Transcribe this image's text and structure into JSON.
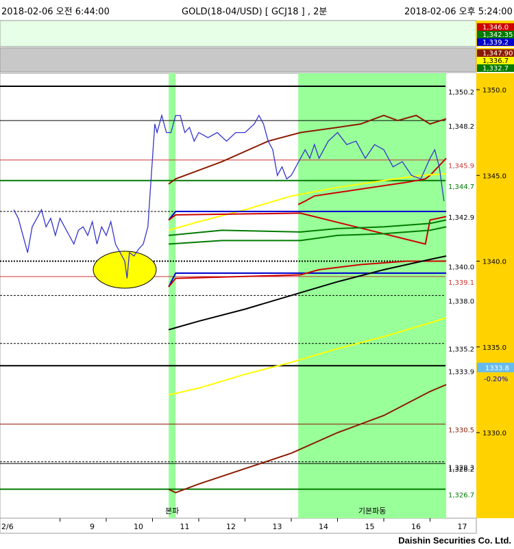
{
  "header": {
    "start_time": "2018-02-06 오전 6:44:00",
    "title": "GOLD(18-04/USD)  [ GCJ18 ] , 2분",
    "end_time": "2018-02-06 오후 5:24:00"
  },
  "top_panel": {
    "labels": [
      {
        "text": "1,346.0",
        "bg": "#cc0000",
        "color": "#ffffff"
      },
      {
        "text": "1,342.35",
        "bg": "#007a00",
        "color": "#ffffff"
      },
      {
        "text": "1,339.2",
        "bg": "#0000cc",
        "color": "#ffffff"
      }
    ]
  },
  "second_panel": {
    "labels": [
      {
        "text": "1,347.90",
        "bg": "#8b1a00",
        "color": "#ffffff"
      },
      {
        "text": "1,336.7",
        "bg": "#ffff00",
        "color": "#000000"
      },
      {
        "text": "1,332.7",
        "bg": "#007a00",
        "color": "#ffffff"
      }
    ]
  },
  "footer": {
    "company": "Daishin Securities Co. Ltd."
  },
  "chart_data": {
    "type": "line",
    "title": "GOLD(18-04/USD)  [ GCJ18 ] , 2분",
    "x_ticks": [
      "2/6",
      "9",
      "10",
      "11",
      "12",
      "13",
      "14",
      "15",
      "16",
      "17"
    ],
    "ylim": [
      1325.0,
      1351.0
    ],
    "y_axis_ticks": [
      1330.0,
      1335.0,
      1340.0,
      1345.0,
      1350.0
    ],
    "y_axis_tick_labels": [
      "1330.0",
      "1335.0",
      "1340.0",
      "1345.0",
      "1350.0"
    ],
    "last_price": {
      "text": "1333.8",
      "change": "-0.20%"
    },
    "shaded_regions": [
      {
        "from": 11.35,
        "to": 11.5,
        "label": "본파"
      },
      {
        "from": 14.15,
        "to": 17.35,
        "label": "기본파동"
      }
    ],
    "annotation": {
      "type": "ellipse",
      "x": 10.4,
      "y": 1339.5,
      "color": "#ffff00"
    },
    "horizontal_levels": [
      {
        "value": 1350.2,
        "label": "1,350.2",
        "color": "#000000",
        "style": "solid",
        "width": 2
      },
      {
        "value": 1348.2,
        "label": "1,348.2",
        "color": "#000000",
        "style": "solid",
        "width": 1
      },
      {
        "value": 1345.9,
        "label": "1,345.9",
        "color": "#cc3333",
        "style": "solid",
        "width": 1
      },
      {
        "value": 1344.7,
        "label": "1,344.7",
        "color": "#007a00",
        "style": "solid",
        "width": 2
      },
      {
        "value": 1342.9,
        "label": "1,342.9",
        "color": "#000000",
        "style": "dashed",
        "width": 1
      },
      {
        "value": 1340.0,
        "label": "1,340.0",
        "color": "#000000",
        "style": "dotted",
        "width": 2
      },
      {
        "value": 1339.1,
        "label": "1,339.1",
        "color": "#cc3333",
        "style": "solid",
        "width": 1
      },
      {
        "value": 1338.0,
        "label": "1,338.0",
        "color": "#000000",
        "style": "dashed",
        "width": 1
      },
      {
        "value": 1335.2,
        "label": "1,335.2",
        "color": "#000000",
        "style": "dashed",
        "width": 1
      },
      {
        "value": 1333.9,
        "label": "1,333.9",
        "color": "#000000",
        "style": "solid",
        "width": 2
      },
      {
        "value": 1330.5,
        "label": "1,330.5",
        "color": "#8b1a00",
        "style": "solid",
        "width": 1
      },
      {
        "value": 1328.3,
        "label": "1,328.3",
        "color": "#000000",
        "style": "dashed",
        "width": 1
      },
      {
        "value": 1328.2,
        "label": "1,328.2",
        "color": "#000000",
        "style": "solid",
        "width": 1
      },
      {
        "value": 1326.7,
        "label": "1,326.7",
        "color": "#007a00",
        "style": "solid",
        "width": 2
      }
    ],
    "price_series": {
      "color": "#3333cc",
      "x": [
        8.0,
        8.1,
        8.2,
        8.3,
        8.4,
        8.5,
        8.6,
        8.7,
        8.8,
        8.9,
        9.0,
        9.1,
        9.2,
        9.3,
        9.4,
        9.5,
        9.6,
        9.7,
        9.8,
        9.9,
        10.0,
        10.1,
        10.2,
        10.3,
        10.4,
        10.45,
        10.5,
        10.6,
        10.7,
        10.8,
        10.9,
        10.95,
        11.0,
        11.05,
        11.1,
        11.2,
        11.3,
        11.4,
        11.5,
        11.6,
        11.7,
        11.8,
        11.9,
        12.0,
        12.2,
        12.4,
        12.6,
        12.8,
        13.0,
        13.2,
        13.3,
        13.4,
        13.5,
        13.6,
        13.7,
        13.8,
        13.9,
        14.0,
        14.1,
        14.2,
        14.3,
        14.4,
        14.5,
        14.6,
        14.8,
        15.0,
        15.2,
        15.4,
        15.6,
        15.8,
        16.0,
        16.2,
        16.4,
        16.6,
        16.8,
        17.0,
        17.1,
        17.2,
        17.3
      ],
      "y": [
        1343.0,
        1342.5,
        1341.5,
        1340.5,
        1342.0,
        1342.5,
        1343.0,
        1342.0,
        1342.5,
        1341.5,
        1342.5,
        1342.0,
        1341.5,
        1341.0,
        1341.8,
        1342.0,
        1341.5,
        1342.3,
        1341.0,
        1342.0,
        1341.5,
        1342.3,
        1341.0,
        1340.5,
        1340.0,
        1339.0,
        1340.5,
        1340.3,
        1340.7,
        1341.0,
        1342.0,
        1344.0,
        1346.0,
        1348.0,
        1347.5,
        1348.5,
        1347.5,
        1347.5,
        1348.5,
        1348.5,
        1347.5,
        1347.8,
        1347.0,
        1347.5,
        1347.2,
        1347.5,
        1347.0,
        1347.5,
        1347.5,
        1348.0,
        1348.5,
        1348.0,
        1347.0,
        1346.5,
        1345.0,
        1345.5,
        1344.8,
        1345.0,
        1345.5,
        1346.0,
        1346.5,
        1346.0,
        1346.8,
        1346.0,
        1347.0,
        1347.5,
        1346.8,
        1347.0,
        1346.0,
        1346.8,
        1346.5,
        1345.5,
        1345.8,
        1345.0,
        1344.8,
        1346.0,
        1346.5,
        1345.5,
        1343.5
      ]
    },
    "indicator_lines": [
      {
        "color": "#8b1a00",
        "x": [
          11.35,
          11.5,
          12.5,
          13.5,
          14.2,
          15.0,
          15.5,
          16.0,
          16.3,
          16.7,
          17.0,
          17.35
        ],
        "y": [
          1344.5,
          1344.8,
          1345.8,
          1347.0,
          1347.5,
          1347.8,
          1348.0,
          1348.5,
          1348.2,
          1348.5,
          1348.0,
          1348.3
        ]
      },
      {
        "color": "#cc0000",
        "x": [
          14.15,
          14.3,
          14.5,
          15.0,
          15.5,
          16.0,
          16.5,
          16.9,
          17.0,
          17.35
        ],
        "y": [
          1343.3,
          1343.5,
          1343.8,
          1344.0,
          1344.2,
          1344.4,
          1344.6,
          1344.8,
          1345.0,
          1346.0
        ]
      },
      {
        "color": "#ffff00",
        "x": [
          11.35,
          12.0,
          13.0,
          14.0,
          15.0,
          16.0,
          16.8,
          17.35
        ],
        "y": [
          1341.8,
          1342.3,
          1343.0,
          1343.8,
          1344.3,
          1344.7,
          1345.0,
          1345.1
        ]
      },
      {
        "color": "#0000cc",
        "x": [
          11.35,
          11.5,
          17.35
        ],
        "y": [
          1342.4,
          1342.9,
          1342.9
        ]
      },
      {
        "color": "#cc0000",
        "x": [
          11.35,
          11.5,
          14.2,
          16.9,
          17.0,
          17.35
        ],
        "y": [
          1342.4,
          1342.7,
          1342.8,
          1341.0,
          1342.4,
          1342.6
        ]
      },
      {
        "color": "#007a00",
        "x": [
          11.35,
          12.5,
          14.2,
          15.0,
          16.0,
          17.0,
          17.35
        ],
        "y": [
          1341.5,
          1341.8,
          1341.7,
          1341.9,
          1342.0,
          1342.2,
          1342.4
        ]
      },
      {
        "color": "#007a00",
        "x": [
          11.35,
          12.5,
          14.2,
          15.0,
          16.0,
          17.0,
          17.35
        ],
        "y": [
          1341.0,
          1341.2,
          1341.2,
          1341.5,
          1341.6,
          1341.8,
          1342.0
        ]
      },
      {
        "color": "#0000cc",
        "x": [
          11.35,
          11.5,
          17.35
        ],
        "y": [
          1338.5,
          1339.3,
          1339.3
        ]
      },
      {
        "color": "#cc0000",
        "x": [
          11.35,
          11.5,
          14.2,
          14.6,
          15.5,
          16.5,
          17.35
        ],
        "y": [
          1338.5,
          1339.0,
          1339.2,
          1339.5,
          1339.8,
          1340.0,
          1340.0
        ]
      },
      {
        "color": "#000000",
        "x": [
          11.35,
          12.0,
          13.0,
          14.0,
          15.0,
          16.0,
          16.5,
          17.0,
          17.35
        ],
        "y": [
          1336.0,
          1336.5,
          1337.2,
          1338.0,
          1338.8,
          1339.5,
          1339.8,
          1340.1,
          1340.3
        ]
      },
      {
        "color": "#ffff00",
        "x": [
          11.35,
          12.0,
          13.0,
          14.0,
          15.0,
          16.0,
          17.0,
          17.35
        ],
        "y": [
          1332.2,
          1332.6,
          1333.4,
          1334.1,
          1334.9,
          1335.6,
          1336.4,
          1336.7
        ]
      },
      {
        "color": "#8b1a00",
        "x": [
          11.35,
          11.5,
          12.0,
          13.0,
          14.0,
          15.0,
          16.0,
          17.0,
          17.35
        ],
        "y": [
          1326.7,
          1326.5,
          1327.0,
          1327.9,
          1328.8,
          1330.0,
          1331.0,
          1332.4,
          1332.8
        ]
      }
    ]
  }
}
